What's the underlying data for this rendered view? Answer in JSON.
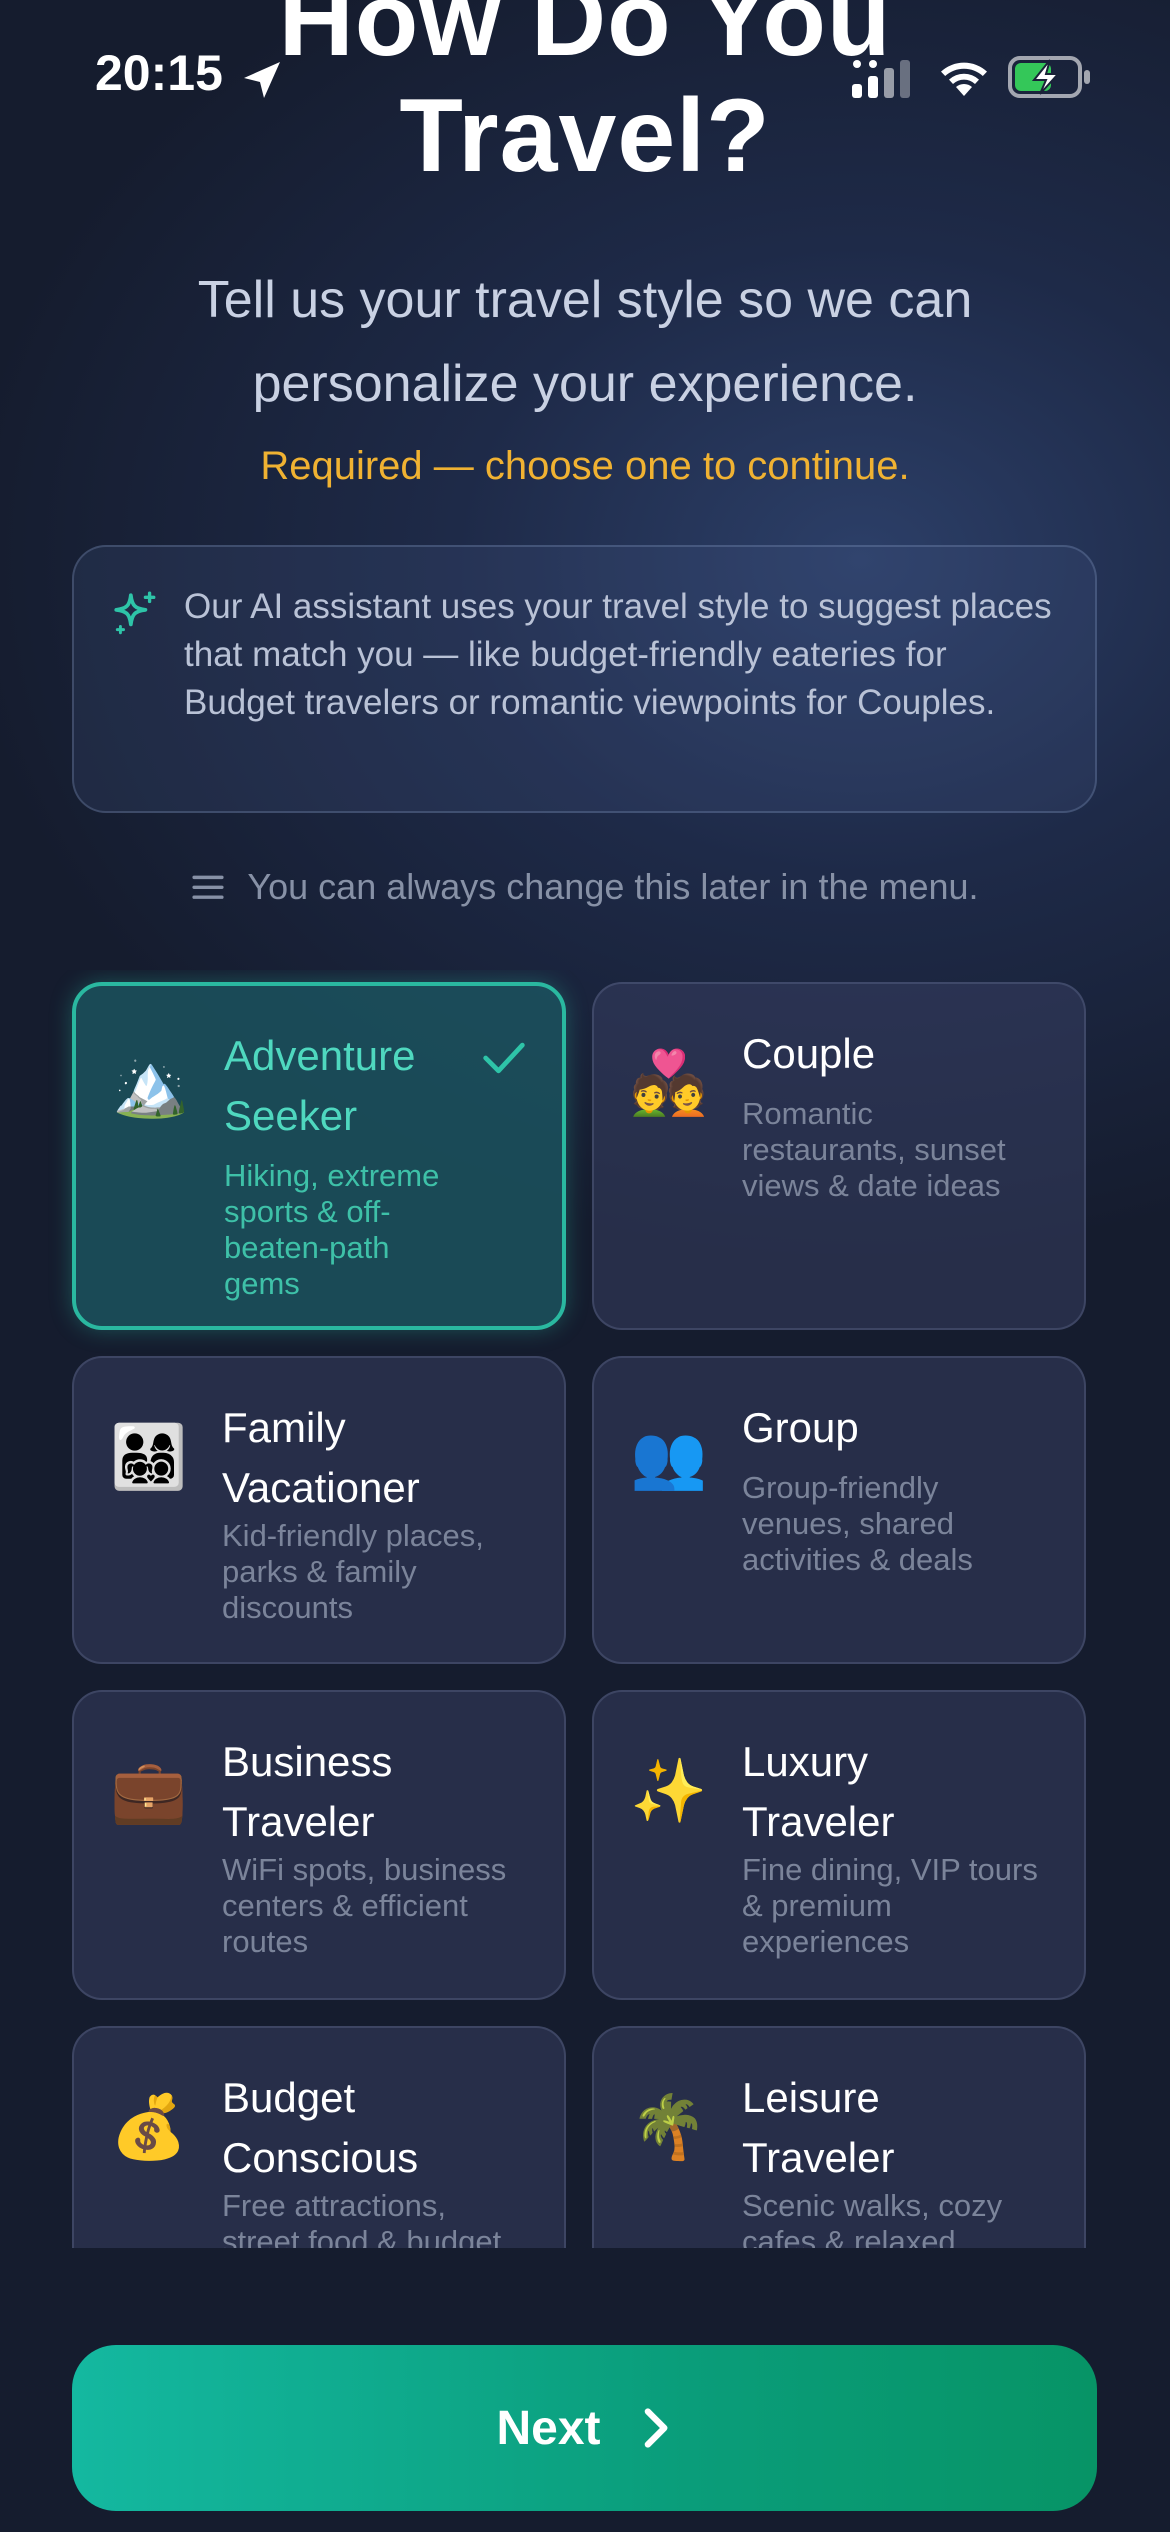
{
  "status_bar": {
    "time": "20:15"
  },
  "header": {
    "title_line1": "How Do You",
    "title_line2": "Travel?",
    "subtitle_line1": "Tell us your travel style so we can",
    "subtitle_line2": "personalize your experience.",
    "required_note": "Required — choose one to continue."
  },
  "info_box": {
    "icon": "sparkle-icon",
    "text": "Our AI assistant uses your travel style to suggest places that match you — like budget-friendly eateries for Budget travelers or romantic viewpoints for Couples."
  },
  "hint": {
    "icon": "menu-icon",
    "text": "You can always change this later in the menu."
  },
  "styles": [
    {
      "emoji": "🏔️",
      "icon": "mountain-icon",
      "title": "Adventure Seeker",
      "description": "Hiking, extreme sports & off-beaten-path gems",
      "selected": true
    },
    {
      "emoji": "💑",
      "icon": "couple-icon",
      "title": "Couple",
      "description": "Romantic restaurants, sunset views & date ideas",
      "selected": false
    },
    {
      "emoji": "👨‍👩‍👧‍👦",
      "icon": "family-icon",
      "title": "Family Vacationer",
      "description": "Kid-friendly places, parks & family discounts",
      "selected": false
    },
    {
      "emoji": "👥",
      "icon": "group-icon",
      "title": "Group",
      "description": "Group-friendly venues, shared activities & deals",
      "selected": false
    },
    {
      "emoji": "💼",
      "icon": "briefcase-icon",
      "title": "Business Traveler",
      "description": "WiFi spots, business centers & efficient routes",
      "selected": false
    },
    {
      "emoji": "✨",
      "icon": "sparkles-icon",
      "title": "Luxury Traveler",
      "description": "Fine dining, VIP tours & premium experiences",
      "selected": false
    },
    {
      "emoji": "💰",
      "icon": "money-bag-icon",
      "title": "Budget Conscious",
      "description": "Free attractions, street food & budget",
      "selected": false
    },
    {
      "emoji": "🌴",
      "icon": "palm-tree-icon",
      "title": "Leisure Traveler",
      "description": "Scenic walks, cozy cafes & relaxed",
      "selected": false
    }
  ],
  "footer": {
    "next_label": "Next"
  },
  "colors": {
    "accent": "#2ab8a0",
    "warning": "#f0b232",
    "button_start": "#14b8a0",
    "button_end": "#079466"
  }
}
